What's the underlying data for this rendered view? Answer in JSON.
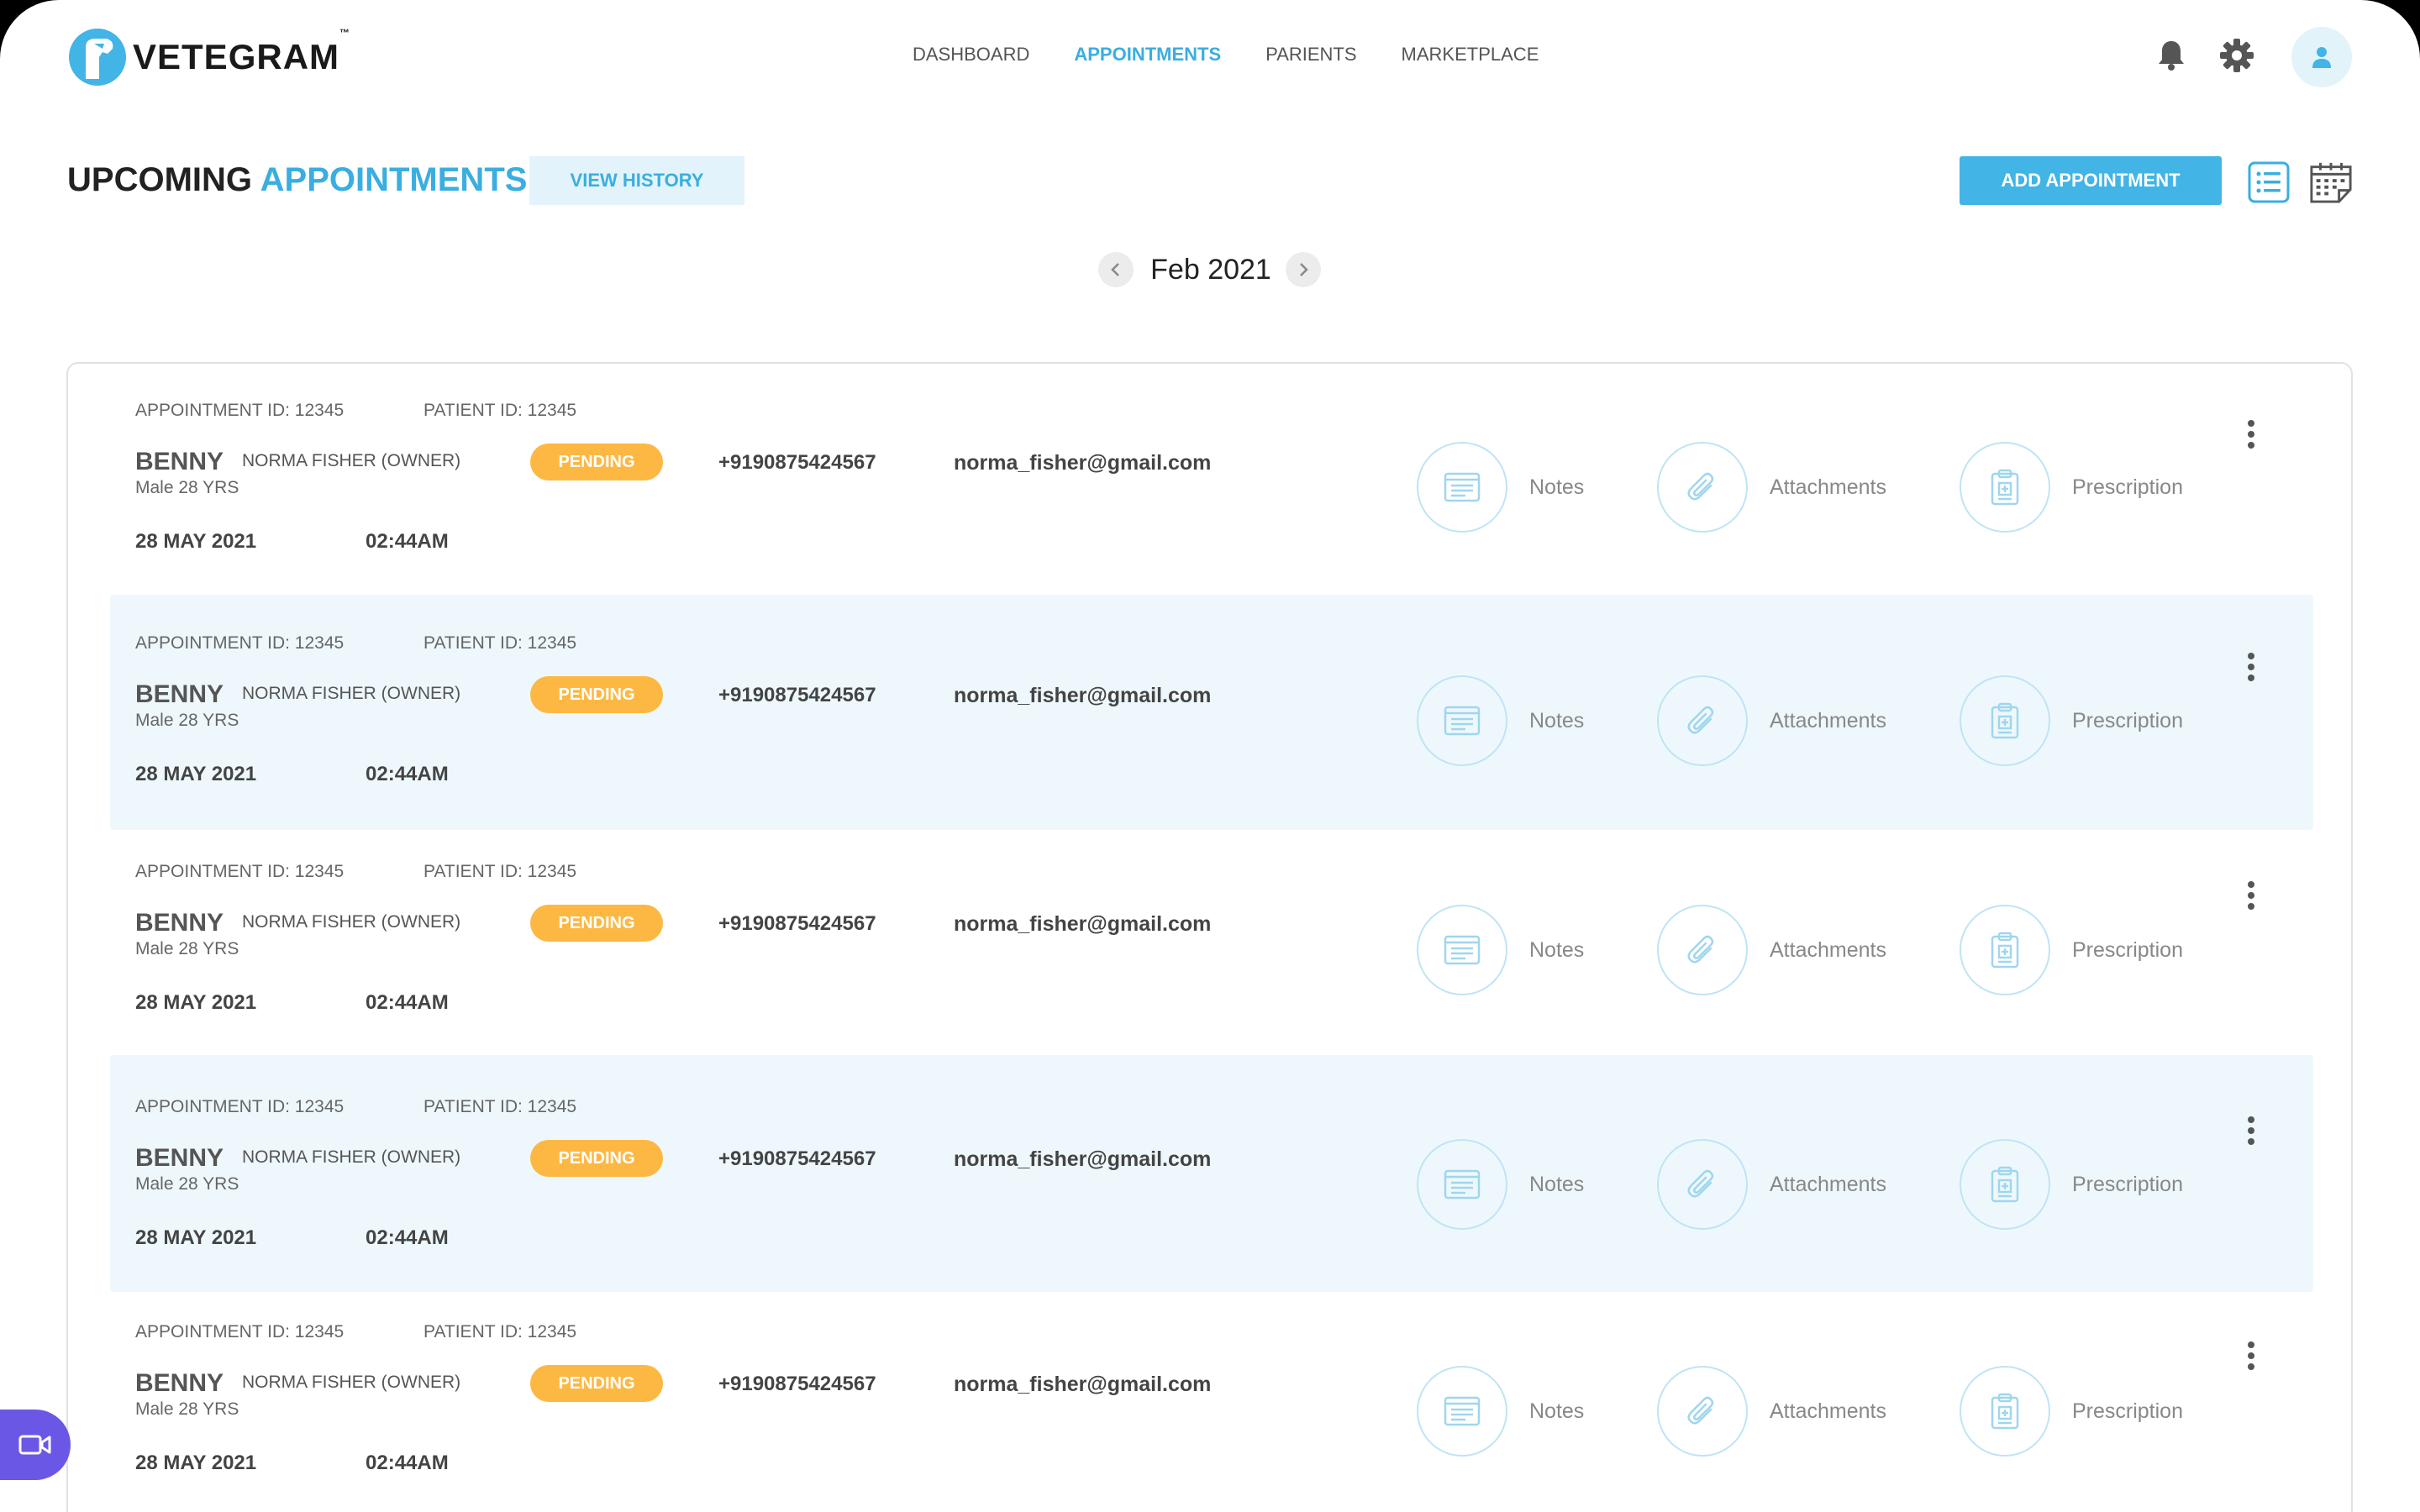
{
  "app": {
    "logo_text": "VETEGRAM",
    "logo_tm": "™"
  },
  "nav": {
    "items": [
      {
        "label": "DASHBOARD",
        "active": false
      },
      {
        "label": "APPOINTMENTS",
        "active": true
      },
      {
        "label": "PARIENTS",
        "active": false
      },
      {
        "label": "MARKETPLACE",
        "active": false
      }
    ]
  },
  "header_icons": [
    "bell-icon",
    "gear-icon",
    "user-icon"
  ],
  "page": {
    "title_prefix": "UPCOMING",
    "title_accent": "APPOINTMENTS",
    "view_history_label": "VIEW HISTORY",
    "add_appointment_label": "ADD APPOINTMENT",
    "view_icons": [
      "list-view-icon",
      "calendar-view-icon"
    ]
  },
  "month_picker": {
    "label": "Feb 2021"
  },
  "appointments": [
    {
      "appointment_id": "APPOINTMENT ID: 12345",
      "patient_id": "PATIENT ID: 12345",
      "pet_name": "BENNY",
      "owner": "NORMA FISHER (OWNER)",
      "pet_meta": "Male 28 YRS",
      "status": "PENDING",
      "phone": "+9190875424567",
      "email": "norma_fisher@gmail.com",
      "date": "28 MAY 2021",
      "time": "02:44AM",
      "actions": {
        "notes": "Notes",
        "attachments": "Attachments",
        "prescription": "Prescription"
      }
    },
    {
      "appointment_id": "APPOINTMENT ID: 12345",
      "patient_id": "PATIENT ID: 12345",
      "pet_name": "BENNY",
      "owner": "NORMA FISHER (OWNER)",
      "pet_meta": "Male 28 YRS",
      "status": "PENDING",
      "phone": "+9190875424567",
      "email": "norma_fisher@gmail.com",
      "date": "28 MAY 2021",
      "time": "02:44AM",
      "actions": {
        "notes": "Notes",
        "attachments": "Attachments",
        "prescription": "Prescription"
      }
    },
    {
      "appointment_id": "APPOINTMENT ID: 12345",
      "patient_id": "PATIENT ID: 12345",
      "pet_name": "BENNY",
      "owner": "NORMA FISHER (OWNER)",
      "pet_meta": "Male 28 YRS",
      "status": "PENDING",
      "phone": "+9190875424567",
      "email": "norma_fisher@gmail.com",
      "date": "28 MAY 2021",
      "time": "02:44AM",
      "actions": {
        "notes": "Notes",
        "attachments": "Attachments",
        "prescription": "Prescription"
      }
    },
    {
      "appointment_id": "APPOINTMENT ID: 12345",
      "patient_id": "PATIENT ID: 12345",
      "pet_name": "BENNY",
      "owner": "NORMA FISHER (OWNER)",
      "pet_meta": "Male 28 YRS",
      "status": "PENDING",
      "phone": "+9190875424567",
      "email": "norma_fisher@gmail.com",
      "date": "28 MAY 2021",
      "time": "02:44AM",
      "actions": {
        "notes": "Notes",
        "attachments": "Attachments",
        "prescription": "Prescription"
      }
    },
    {
      "appointment_id": "APPOINTMENT ID: 12345",
      "patient_id": "PATIENT ID: 12345",
      "pet_name": "BENNY",
      "owner": "NORMA FISHER (OWNER)",
      "pet_meta": "Male 28 YRS",
      "status": "PENDING",
      "phone": "+9190875424567",
      "email": "norma_fisher@gmail.com",
      "date": "28 MAY 2021",
      "time": "02:44AM",
      "actions": {
        "notes": "Notes",
        "attachments": "Attachments",
        "prescription": "Prescription"
      }
    }
  ],
  "colors": {
    "accent": "#3aaee0",
    "primary_button": "#42b4e6",
    "status_pending": "#fdb843",
    "row_shade": "#eef8fc",
    "video_fab": "#6b57e6"
  },
  "floating": {
    "video_icon": "video-camera-icon"
  }
}
